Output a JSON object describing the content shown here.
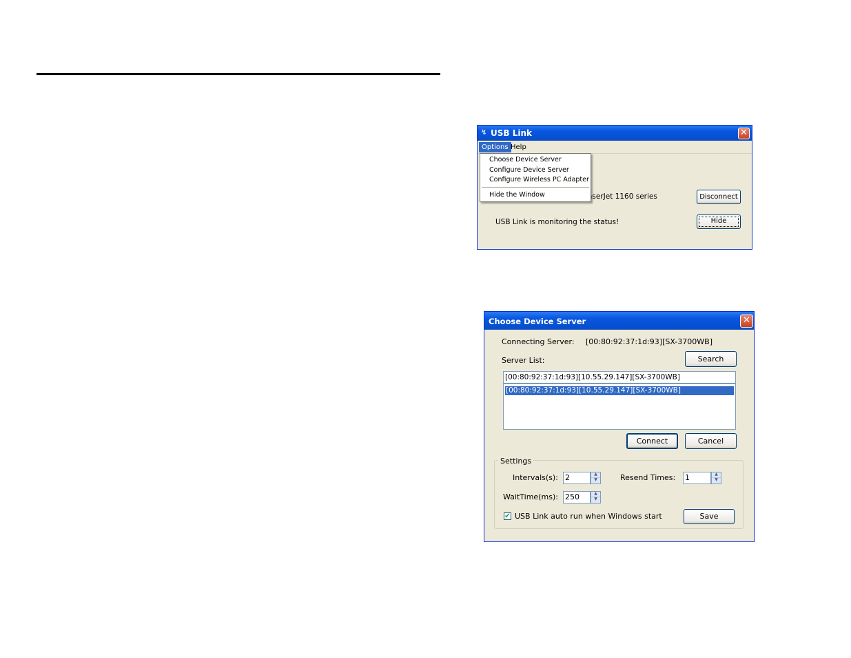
{
  "usb_link": {
    "title": "USB Link",
    "menu": {
      "options": "Options",
      "help": "Help"
    },
    "dropdown": {
      "choose": "Choose Device Server",
      "configure": "Configure Device Server",
      "wireless": "Configure Wireless PC Adapter",
      "hide": "Hide the Window"
    },
    "printer_text": "aserJet 1160 series",
    "status_text": "USB Link is monitoring the status!",
    "disconnect_label": "Disconnect",
    "hide_label": "Hide"
  },
  "choose_device_server": {
    "title": "Choose Device Server",
    "connecting_label": "Connecting Server:",
    "connecting_value": "[00:80:92:37:1d:93][SX-3700WB]",
    "server_list_label": "Server List:",
    "search_label": "Search",
    "selected_entry": "[00:80:92:37:1d:93][10.55.29.147][SX-3700WB]",
    "server_list": [
      "[00:80:92:37:1d:93][10.55.29.147][SX-3700WB]"
    ],
    "connect_label": "Connect",
    "cancel_label": "Cancel",
    "settings": {
      "legend": "Settings",
      "intervals_label": "Intervals(s):",
      "intervals_value": "2",
      "resend_label": "Resend Times:",
      "resend_value": "1",
      "wait_label": "WaitTime(ms):",
      "wait_value": "250",
      "autorun_label": "USB Link auto run when Windows start",
      "autorun_checked": true,
      "save_label": "Save"
    }
  },
  "icons": {
    "close": "close-icon",
    "app": "usb-link-app-icon",
    "check": "checkmark-icon",
    "spin_up": "spin-up-icon",
    "spin_down": "spin-down-icon"
  },
  "colors": {
    "titlebar": "#0552d5",
    "close": "#c8411e",
    "selection": "#316ac5",
    "window": "#ece9d8"
  }
}
